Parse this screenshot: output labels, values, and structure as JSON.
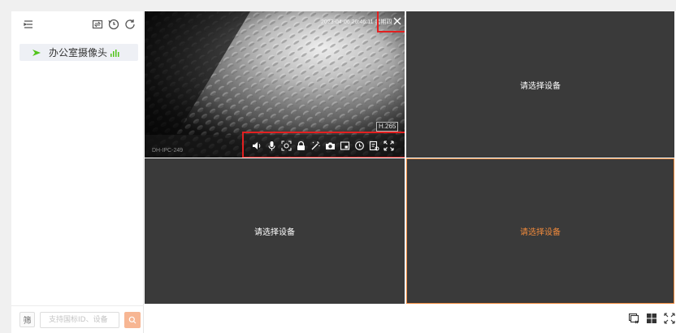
{
  "sidebar": {
    "device_name": "办公室摄像头",
    "search_placeholder": "支持国标ID、设备",
    "filter_label": "筛"
  },
  "video": {
    "osd_time": "2023-04-06 20:46:11 星期四",
    "codec": "H.265",
    "camera_label": "DH-IPC-249"
  },
  "cells": {
    "top_right": "请选择设备",
    "bottom_left": "请选择设备",
    "bottom_right": "请选择设备"
  },
  "toolbar_icons": [
    "speaker-icon",
    "mic-icon",
    "zoom-icon",
    "lock-icon",
    "magic-wand-icon",
    "camera-icon",
    "window-icon",
    "history-icon",
    "record-icon",
    "fullscreen-icon"
  ],
  "colors": {
    "accent": "#f08a3c",
    "highlight": "#e32020",
    "online": "#52c41a"
  }
}
